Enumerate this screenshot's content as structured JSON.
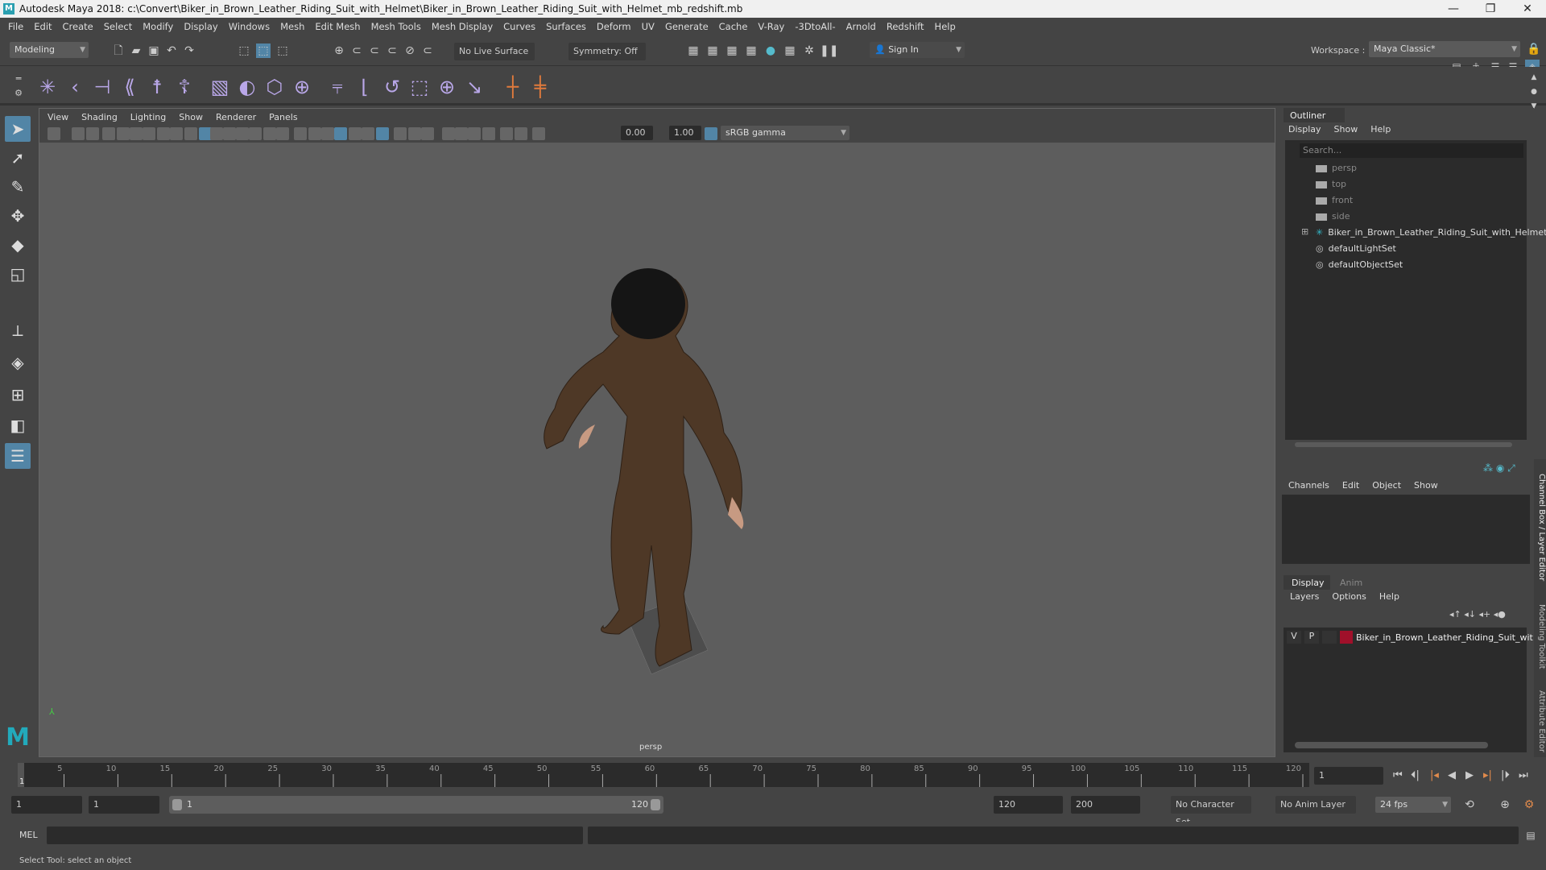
{
  "window": {
    "title": "Autodesk Maya 2018: c:\\Convert\\Biker_in_Brown_Leather_Riding_Suit_with_Helmet\\Biker_in_Brown_Leather_Riding_Suit_with_Helmet_mb_redshift.mb",
    "minimize": "—",
    "restore": "❐",
    "close": "✕"
  },
  "menubar": [
    "File",
    "Edit",
    "Create",
    "Select",
    "Modify",
    "Display",
    "Windows",
    "Mesh",
    "Edit Mesh",
    "Mesh Tools",
    "Mesh Display",
    "Curves",
    "Surfaces",
    "Deform",
    "UV",
    "Generate",
    "Cache",
    "V-Ray",
    "-3DtoAll-",
    "Arnold",
    "Redshift",
    "Help"
  ],
  "status": {
    "mode": "Modeling",
    "live_surface": "No Live Surface",
    "symmetry": "Symmetry: Off",
    "sign_in": "Sign In",
    "workspace_label": "Workspace :",
    "workspace": "Maya Classic*"
  },
  "viewport": {
    "menu": [
      "View",
      "Shading",
      "Lighting",
      "Show",
      "Renderer",
      "Panels"
    ],
    "exposure": "0.00",
    "gamma": "1.00",
    "color_space": "sRGB gamma",
    "camera_label": "persp"
  },
  "outliner": {
    "title": "Outliner",
    "menu": [
      "Display",
      "Show",
      "Help"
    ],
    "search_placeholder": "Search...",
    "items": [
      "persp",
      "top",
      "front",
      "side",
      "Biker_in_Brown_Leather_Riding_Suit_with_Helmet_",
      "defaultLightSet",
      "defaultObjectSet"
    ]
  },
  "channel_box": {
    "menu": [
      "Channels",
      "Edit",
      "Object",
      "Show"
    ]
  },
  "layer_editor": {
    "tabs": [
      "Display",
      "Anim"
    ],
    "menu": [
      "Layers",
      "Options",
      "Help"
    ],
    "layer": {
      "v": "V",
      "p": "P",
      "name": "Biker_in_Brown_Leather_Riding_Suit_wit",
      "color": "#a0102a"
    }
  },
  "side_tabs": [
    "Channel Box / Layer Editor",
    "Modeling Toolkit",
    "Attribute Editor"
  ],
  "timeline": {
    "start": 1,
    "end": 120,
    "current": 1,
    "current_frame_field": "1"
  },
  "range": {
    "start": "1",
    "anim_start": "1",
    "slider_start": "1",
    "slider_end": "120",
    "end": "120",
    "anim_end": "200",
    "character_set": "No Character Set",
    "anim_layer": "No Anim Layer",
    "fps": "24 fps"
  },
  "mel": {
    "label": "MEL"
  },
  "help_line": "Select Tool: select an object"
}
